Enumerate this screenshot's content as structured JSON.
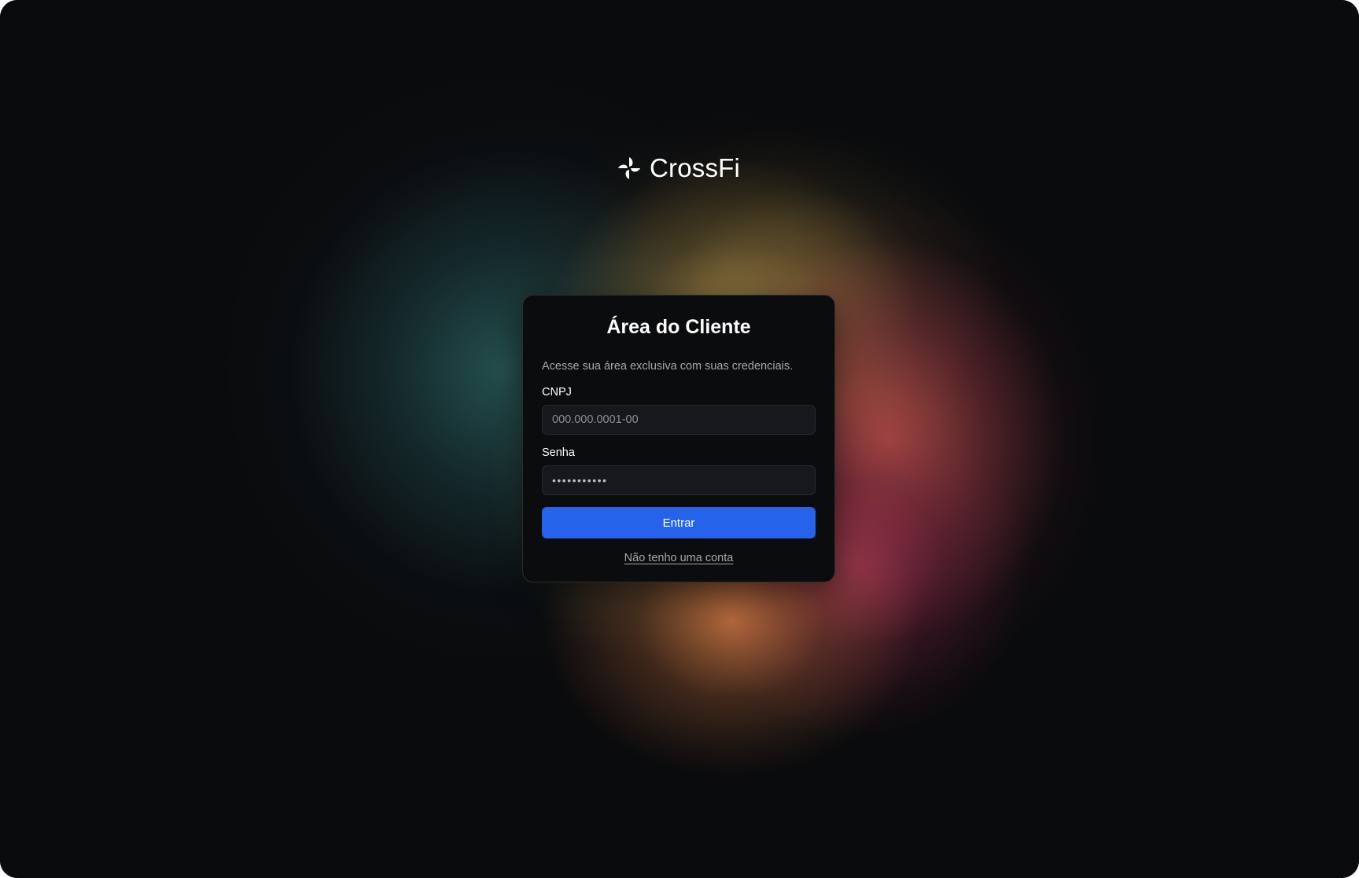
{
  "brand": {
    "name": "CrossFi",
    "icon": "crossfi-pinwheel-logo"
  },
  "login": {
    "title": "Área do Cliente",
    "subtitle": "Acesse sua área exclusiva com suas credenciais.",
    "cnpj_label": "CNPJ",
    "cnpj_placeholder": "000.000.0001-00",
    "password_label": "Senha",
    "password_value": "•••••••••••",
    "submit_label": "Entrar",
    "signup_link": "Não tenho uma conta"
  },
  "colors": {
    "background": "#0a0b0d",
    "card": "#0b0c0e",
    "input": "#17181b",
    "accent": "#2563eb"
  }
}
